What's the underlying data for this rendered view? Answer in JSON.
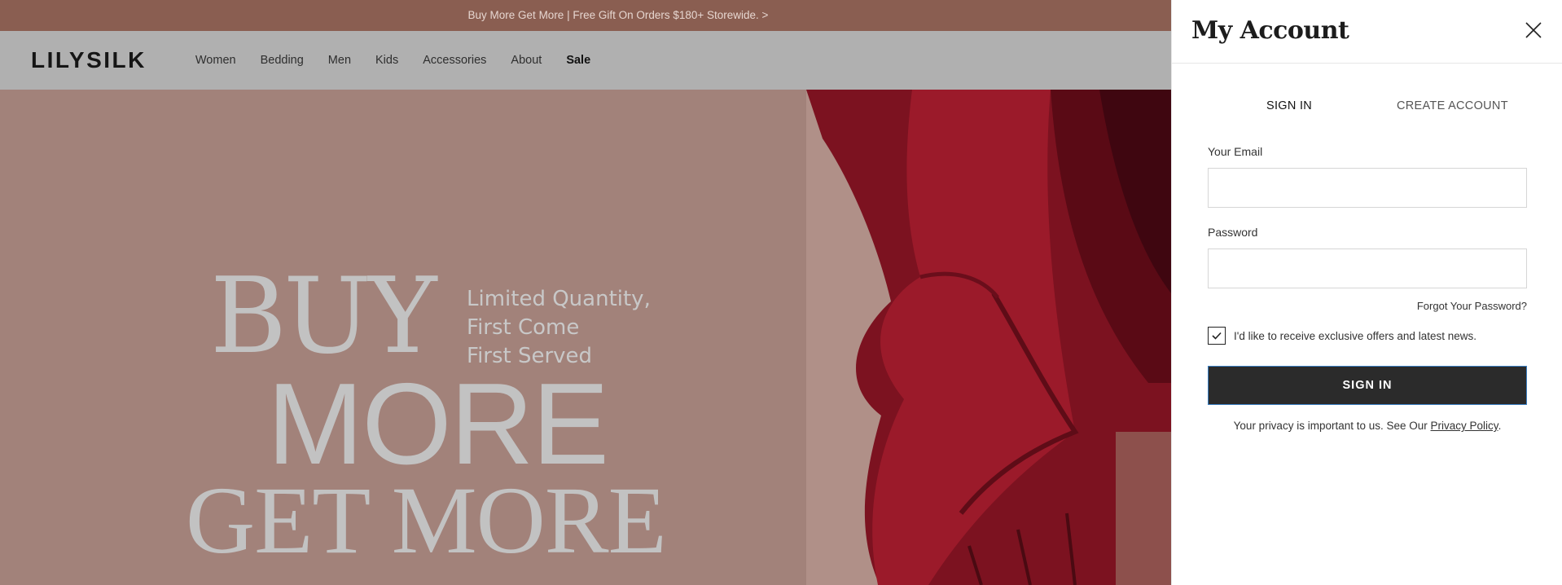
{
  "promo": {
    "text": "Buy More Get More | Free Gift On Orders $180+ Storewide. >"
  },
  "header": {
    "logo": "LILYSILK",
    "nav": [
      "Women",
      "Bedding",
      "Men",
      "Kids",
      "Accessories",
      "About",
      "Sale"
    ]
  },
  "hero": {
    "line1": "BUY",
    "line2": "MORE",
    "line3": "GET MORE",
    "tag1": "Limited Quantity,",
    "tag2": "First Come",
    "tag3": "First Served"
  },
  "account": {
    "title": "My Account",
    "tab_signin": "SIGN IN",
    "tab_create": "CREATE ACCOUNT",
    "email_label": "Your Email",
    "email_value": "",
    "password_label": "Password",
    "password_value": "",
    "forgot": "Forgot Your Password?",
    "offers_label": "I'd like to receive exclusive offers and latest news.",
    "offers_checked": true,
    "submit": "SIGN IN",
    "privacy_text": "Your privacy is important to us. See Our ",
    "privacy_link": "Privacy Policy",
    "privacy_end": "."
  },
  "colors": {
    "overlay_page": "#a2827a",
    "promo_bg": "#8a5e51",
    "header_bg": "#b0b0b0",
    "button_bg": "#2b2b2b",
    "cloth": "#8b1a26"
  },
  "icons": {
    "close": "close-icon",
    "check": "check-icon"
  }
}
